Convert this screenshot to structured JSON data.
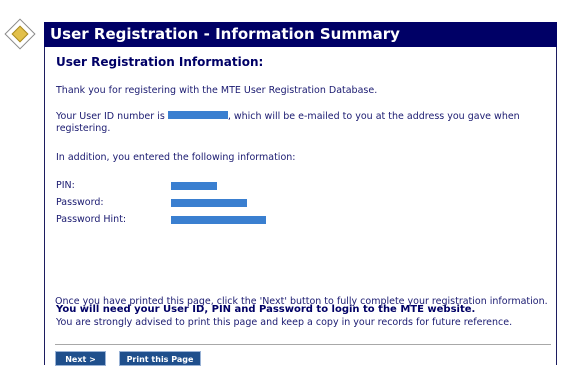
{
  "header": {
    "title": "User Registration - Information Summary"
  },
  "section": {
    "heading": "User Registration Information:"
  },
  "messages": {
    "thank_you": "Thank you for registering with the MTE User Registration Database.",
    "user_id_prefix": "Your User ID number is",
    "user_id_suffix": ", which will be e-mailed to you at the address you gave when registering.",
    "in_addition": "In addition, you entered the following information:",
    "login_notice": "You will need your User ID, PIN and Password to login to the MTE website.",
    "print_advice": "You are strongly advised to print this page and keep a copy in your records for future reference.",
    "next_instruction": "Once you have printed this page, click the 'Next' button to fully complete your registration information."
  },
  "info_fields": {
    "pin": "PIN:",
    "password": "Password:",
    "password_hint": "Password Hint:"
  },
  "buttons": {
    "next": "Next >",
    "print": "Print this Page"
  },
  "colors": {
    "header_bg": "#000066",
    "redaction": "#3a7fd0",
    "button_bg": "#1f4f8c"
  }
}
